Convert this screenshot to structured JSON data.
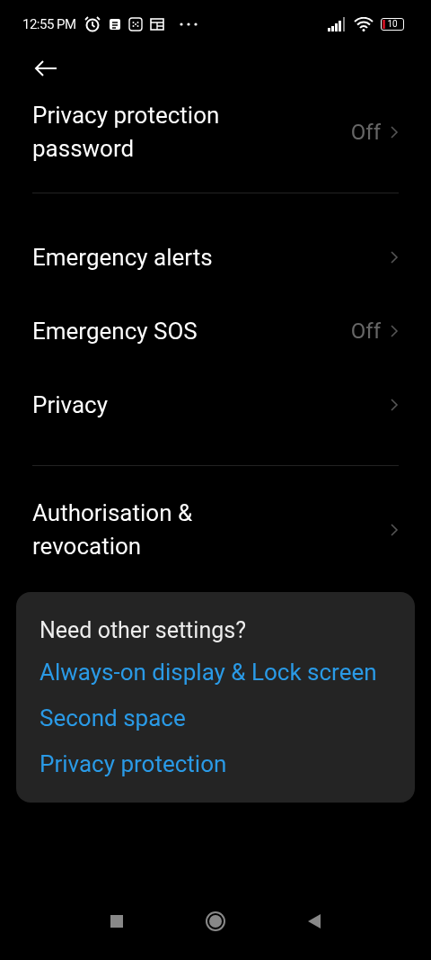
{
  "status_bar": {
    "time": "12:55 PM",
    "battery": "10"
  },
  "groups": [
    {
      "items": [
        {
          "title": "Privacy protection password",
          "value": "Off"
        }
      ]
    },
    {
      "items": [
        {
          "title": "Emergency alerts"
        },
        {
          "title": "Emergency SOS",
          "value": "Off"
        },
        {
          "title": "Privacy"
        }
      ]
    },
    {
      "items": [
        {
          "title": "Authorisation & revocation"
        }
      ]
    }
  ],
  "suggestions": {
    "title": "Need other settings?",
    "links": [
      "Always-on display & Lock screen",
      "Second space",
      "Privacy protection"
    ]
  }
}
